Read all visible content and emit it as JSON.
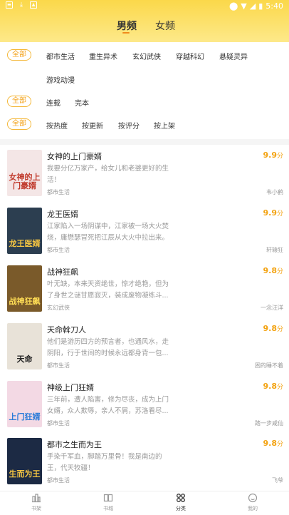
{
  "status_bar": {
    "time": "5:40"
  },
  "header": {
    "tabs": [
      {
        "label": "男频"
      },
      {
        "label": "女频"
      }
    ]
  },
  "filters": {
    "all_label": "全部",
    "genres": [
      "都市生活",
      "重生异术",
      "玄幻武侠",
      "穿越科幻",
      "悬疑灵异",
      "游戏动漫"
    ],
    "status": [
      "连载",
      "完本"
    ],
    "sort": [
      "按热度",
      "按更新",
      "按评分",
      "按上架"
    ]
  },
  "colors": {
    "accent": "#f4a21a",
    "header": "#fbd84a",
    "score": "#f3a312"
  },
  "score_unit": "分",
  "books": [
    {
      "title": "女神的上门豪婿",
      "score": "9.9",
      "desc": "我要分亿万家产，给女儿和老婆更好的生活！",
      "category": "都市生活",
      "author": "韦小鹤",
      "cover_text": "女神的上门豪婿",
      "cover_bg": "#f4e6e6",
      "cover_color": "#c0392b"
    },
    {
      "title": "龙王医婿",
      "score": "9.9",
      "desc": "江家陷入一场阴谋中，江家被一场大火焚烧，庸懋瑟冒死把江辰从大火中拉出来。十",
      "category": "都市生活",
      "author": "轩辕狂",
      "cover_text": "龙王医婿",
      "cover_bg": "#2c3e50",
      "cover_color": "#f5c542"
    },
    {
      "title": "战神狂飙",
      "score": "9.8",
      "desc": "叶无缺，本来天资绝世，惊才绝艳，但为了身世之谜甘愿寂灭，装成废物凝练斗...",
      "category": "玄幻武侠",
      "author": "一念汪洋",
      "cover_text": "战神狂飙",
      "cover_bg": "#7a5a2a",
      "cover_color": "#ffdd55"
    },
    {
      "title": "天命斡刀人",
      "score": "9.8",
      "desc": "他们是游历四方的预言者，也通风水，走阴阳，行于世间的时候永远都身背一包...",
      "category": "都市生活",
      "author": "困的睡不着",
      "cover_text": "天命",
      "cover_bg": "#e8e2d8",
      "cover_color": "#222222"
    },
    {
      "title": "神级上门狂婿",
      "score": "9.8",
      "desc": "三年前，遭人陷害，修为尽丧，成为上门女婿，众人欺辱，亲人不屑，苏洛看尽...",
      "category": "都市生活",
      "author": "踏一步咸仙",
      "cover_text": "上门狂婿",
      "cover_bg": "#f3d9e4",
      "cover_color": "#2a7bd8"
    },
    {
      "title": "都市之生而为王",
      "score": "9.8",
      "desc": "手染千军血，脚踏万里骨！我是南边的王，代天牧疆！",
      "category": "都市生活",
      "author": "飞爷",
      "cover_text": "生而为王",
      "cover_bg": "#1c2a44",
      "cover_color": "#f5c542"
    }
  ],
  "bottom_nav": [
    {
      "label": "书架"
    },
    {
      "label": "书城"
    },
    {
      "label": "分类"
    },
    {
      "label": "我的"
    }
  ]
}
